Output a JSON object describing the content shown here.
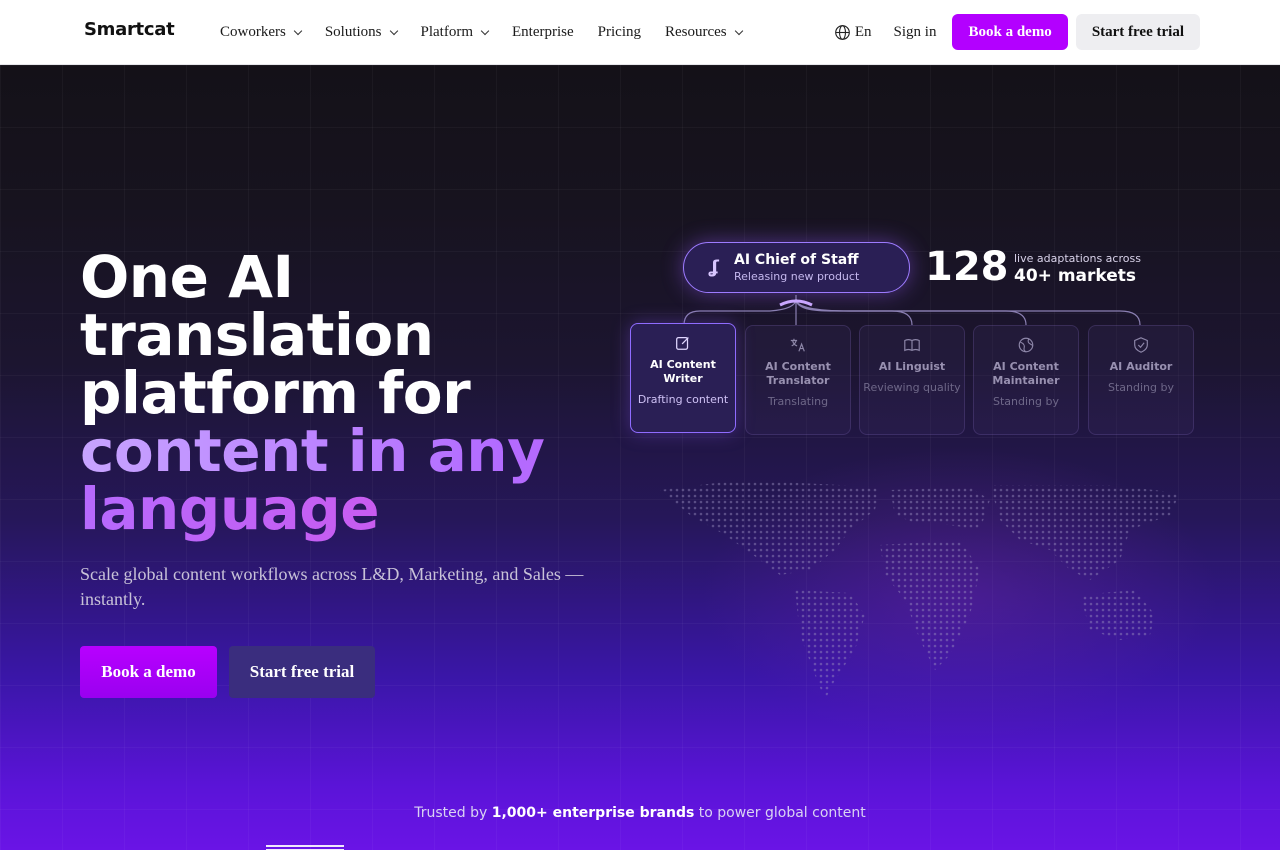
{
  "nav": {
    "logo": "Smartcat",
    "links": [
      {
        "label": "Coworkers",
        "dropdown": true
      },
      {
        "label": "Solutions",
        "dropdown": true
      },
      {
        "label": "Platform",
        "dropdown": true
      },
      {
        "label": "Enterprise",
        "dropdown": false
      },
      {
        "label": "Pricing",
        "dropdown": false
      },
      {
        "label": "Resources",
        "dropdown": true
      }
    ],
    "language": "En",
    "sign_in": "Sign in",
    "book_demo": "Book a demo",
    "start_trial": "Start free trial",
    "accent": "#b300ff"
  },
  "hero": {
    "headline_white": "One AI translation platform for",
    "headline_gradient": "content in any language",
    "subtitle": "Scale global content workflows across L&D, Marketing, and Sales — instantly.",
    "book_demo": "Book a demo",
    "start_trial": "Start free trial"
  },
  "diagram": {
    "chief": {
      "title": "AI Chief of Staff",
      "status": "Releasing new product",
      "icon": "smartcat-logo-icon"
    },
    "stat": {
      "number": "128",
      "label_small": "live adaptations across",
      "label_big": "40+ markets"
    },
    "agents": [
      {
        "title": "AI Content Writer",
        "status": "Drafting content",
        "icon": "edit-icon",
        "active": true
      },
      {
        "title": "AI Content Translator",
        "status": "Translating",
        "icon": "translate-icon",
        "active": false
      },
      {
        "title": "AI Linguist",
        "status": "Reviewing quality",
        "icon": "book-icon",
        "active": false
      },
      {
        "title": "AI Content Maintainer",
        "status": "Standing by",
        "icon": "globe-icon",
        "active": false
      },
      {
        "title": "AI Auditor",
        "status": "Standing by",
        "icon": "shield-check-icon",
        "active": false
      }
    ]
  },
  "trusted": {
    "prefix": "Trusted by ",
    "highlight": "1,000+ enterprise brands",
    "suffix": " to power global content"
  }
}
